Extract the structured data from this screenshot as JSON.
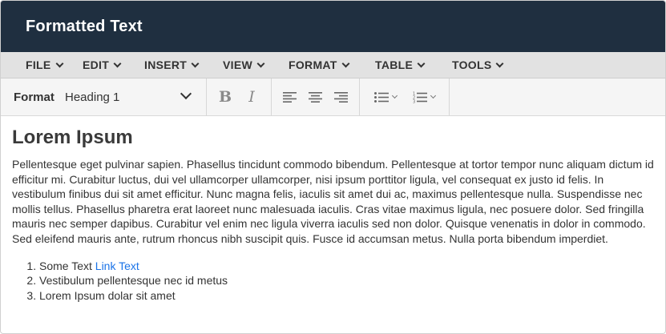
{
  "window": {
    "title": "Formatted Text"
  },
  "menubar": {
    "items": [
      {
        "label": "FILE"
      },
      {
        "label": "EDIT"
      },
      {
        "label": "INSERT"
      },
      {
        "label": "VIEW"
      },
      {
        "label": "FORMAT"
      },
      {
        "label": "TABLE"
      },
      {
        "label": "TOOLS"
      }
    ]
  },
  "toolbar": {
    "format_label": "Format",
    "format_value": "Heading 1",
    "bold_glyph": "B",
    "italic_glyph": "I",
    "icons": [
      "bold-icon",
      "italic-icon",
      "align-left-icon",
      "align-center-icon",
      "align-right-icon",
      "bullet-list-icon",
      "numbered-list-icon"
    ]
  },
  "document": {
    "heading": "Lorem Ipsum",
    "paragraph": "Pellentesque eget pulvinar sapien. Phasellus tincidunt commodo bibendum. Pellentesque at tortor tempor nunc aliquam dictum id efficitur mi. Curabitur luctus, dui vel ullamcorper ullamcorper, nisi ipsum porttitor ligula, vel consequat ex justo id felis. In vestibulum finibus dui sit amet efficitur. Nunc magna felis, iaculis sit amet dui ac, maximus pellentesque nulla. Suspendisse nec mollis tellus. Phasellus pharetra erat laoreet nunc malesuada iaculis. Cras vitae maximus ligula, nec posuere dolor. Sed fringilla mauris nec semper dapibus. Curabitur vel enim nec ligula viverra iaculis sed non dolor. Quisque venenatis in dolor in commodo. Sed eleifend mauris ante, rutrum rhoncus nibh suscipit quis. Fusce id accumsan metus. Nulla porta bibendum imperdiet.",
    "list": [
      {
        "text": "Some Text ",
        "link": "Link Text"
      },
      {
        "text": "Vestibulum pellentesque nec id metus"
      },
      {
        "text": "Lorem Ipsum dolar sit amet"
      }
    ]
  },
  "colors": {
    "titlebar_bg": "#1f2f40",
    "menubar_bg": "#e2e2e2",
    "toolbar_bg": "#f5f5f5",
    "link": "#1a73e8"
  }
}
